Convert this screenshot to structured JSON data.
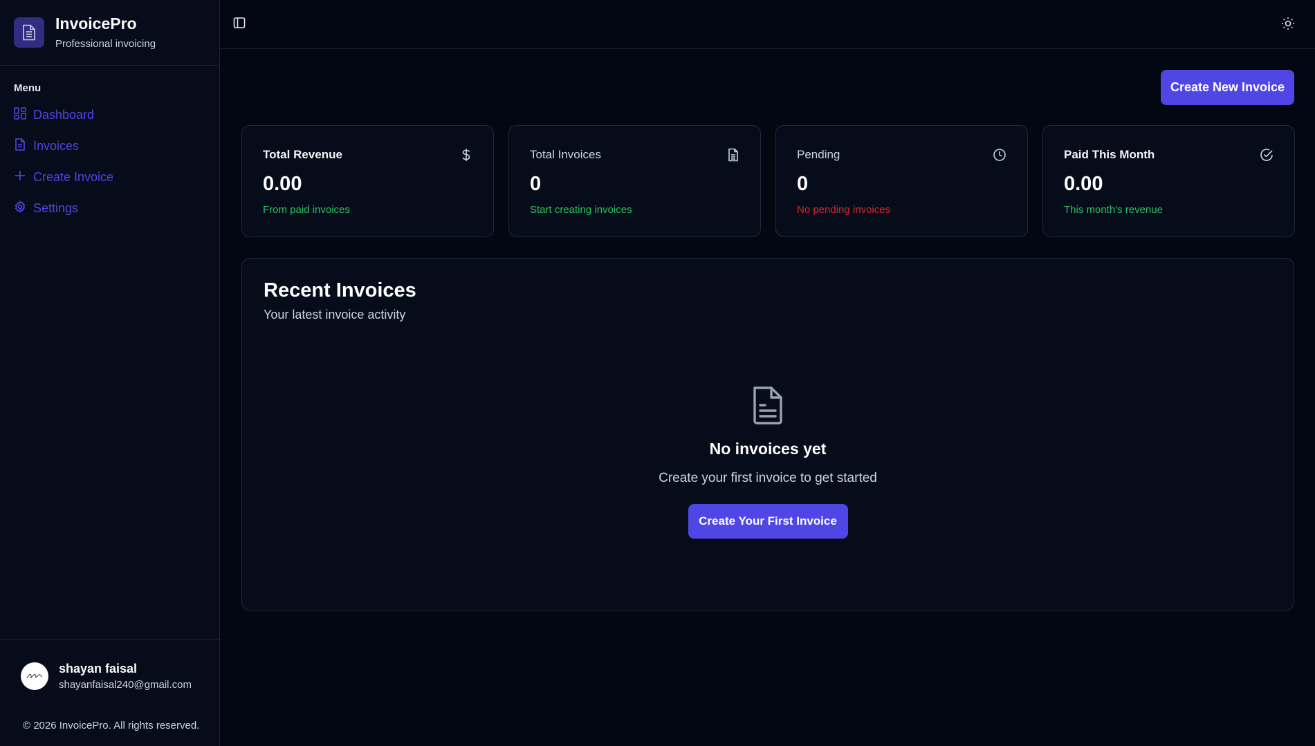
{
  "brand": {
    "name": "InvoicePro",
    "tagline": "Professional invoicing"
  },
  "sidebar": {
    "menu_label": "Menu",
    "items": [
      {
        "label": "Dashboard",
        "icon": "dashboard-icon"
      },
      {
        "label": "Invoices",
        "icon": "file-icon"
      },
      {
        "label": "Create Invoice",
        "icon": "plus-icon"
      },
      {
        "label": "Settings",
        "icon": "gear-icon"
      }
    ]
  },
  "user": {
    "name": "shayan faisal",
    "email": "shayanfaisal240@gmail.com"
  },
  "footer": {
    "copyright": "© 2026 InvoicePro. All rights reserved."
  },
  "header": {
    "create_button": "Create New Invoice"
  },
  "stats": [
    {
      "title": "Total Revenue",
      "value": "0.00",
      "sub": "From paid invoices",
      "icon": "dollar-icon",
      "sub_color": "#22c55e"
    },
    {
      "title": "Total Invoices",
      "value": "0",
      "sub": "Start creating invoices",
      "icon": "file-icon",
      "sub_color": "#22c55e"
    },
    {
      "title": "Pending",
      "value": "0",
      "sub": "No pending invoices",
      "icon": "clock-icon",
      "sub_color": "#dc2626"
    },
    {
      "title": "Paid This Month",
      "value": "0.00",
      "sub": "This month's revenue",
      "icon": "check-circle-icon",
      "sub_color": "#22c55e"
    }
  ],
  "recent": {
    "title": "Recent Invoices",
    "subtitle": "Your latest invoice activity",
    "empty_title": "No invoices yet",
    "empty_subtitle": "Create your first invoice to get started",
    "empty_button": "Create Your First Invoice"
  },
  "colors": {
    "accent": "#4f46e5",
    "background": "#030712",
    "card": "#070c1a",
    "positive": "#22c55e",
    "negative": "#dc2626"
  }
}
